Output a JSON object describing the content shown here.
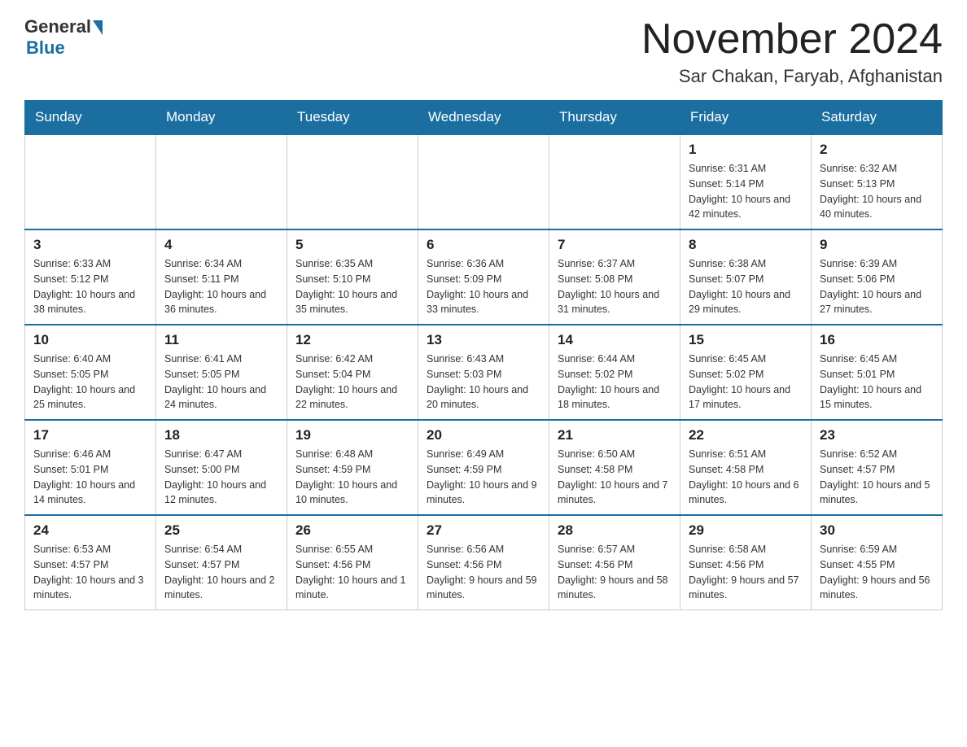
{
  "header": {
    "logo_general": "General",
    "logo_blue": "Blue",
    "month_title": "November 2024",
    "location": "Sar Chakan, Faryab, Afghanistan"
  },
  "days_of_week": [
    "Sunday",
    "Monday",
    "Tuesday",
    "Wednesday",
    "Thursday",
    "Friday",
    "Saturday"
  ],
  "weeks": [
    [
      {
        "day": "",
        "info": ""
      },
      {
        "day": "",
        "info": ""
      },
      {
        "day": "",
        "info": ""
      },
      {
        "day": "",
        "info": ""
      },
      {
        "day": "",
        "info": ""
      },
      {
        "day": "1",
        "info": "Sunrise: 6:31 AM\nSunset: 5:14 PM\nDaylight: 10 hours and 42 minutes."
      },
      {
        "day": "2",
        "info": "Sunrise: 6:32 AM\nSunset: 5:13 PM\nDaylight: 10 hours and 40 minutes."
      }
    ],
    [
      {
        "day": "3",
        "info": "Sunrise: 6:33 AM\nSunset: 5:12 PM\nDaylight: 10 hours and 38 minutes."
      },
      {
        "day": "4",
        "info": "Sunrise: 6:34 AM\nSunset: 5:11 PM\nDaylight: 10 hours and 36 minutes."
      },
      {
        "day": "5",
        "info": "Sunrise: 6:35 AM\nSunset: 5:10 PM\nDaylight: 10 hours and 35 minutes."
      },
      {
        "day": "6",
        "info": "Sunrise: 6:36 AM\nSunset: 5:09 PM\nDaylight: 10 hours and 33 minutes."
      },
      {
        "day": "7",
        "info": "Sunrise: 6:37 AM\nSunset: 5:08 PM\nDaylight: 10 hours and 31 minutes."
      },
      {
        "day": "8",
        "info": "Sunrise: 6:38 AM\nSunset: 5:07 PM\nDaylight: 10 hours and 29 minutes."
      },
      {
        "day": "9",
        "info": "Sunrise: 6:39 AM\nSunset: 5:06 PM\nDaylight: 10 hours and 27 minutes."
      }
    ],
    [
      {
        "day": "10",
        "info": "Sunrise: 6:40 AM\nSunset: 5:05 PM\nDaylight: 10 hours and 25 minutes."
      },
      {
        "day": "11",
        "info": "Sunrise: 6:41 AM\nSunset: 5:05 PM\nDaylight: 10 hours and 24 minutes."
      },
      {
        "day": "12",
        "info": "Sunrise: 6:42 AM\nSunset: 5:04 PM\nDaylight: 10 hours and 22 minutes."
      },
      {
        "day": "13",
        "info": "Sunrise: 6:43 AM\nSunset: 5:03 PM\nDaylight: 10 hours and 20 minutes."
      },
      {
        "day": "14",
        "info": "Sunrise: 6:44 AM\nSunset: 5:02 PM\nDaylight: 10 hours and 18 minutes."
      },
      {
        "day": "15",
        "info": "Sunrise: 6:45 AM\nSunset: 5:02 PM\nDaylight: 10 hours and 17 minutes."
      },
      {
        "day": "16",
        "info": "Sunrise: 6:45 AM\nSunset: 5:01 PM\nDaylight: 10 hours and 15 minutes."
      }
    ],
    [
      {
        "day": "17",
        "info": "Sunrise: 6:46 AM\nSunset: 5:01 PM\nDaylight: 10 hours and 14 minutes."
      },
      {
        "day": "18",
        "info": "Sunrise: 6:47 AM\nSunset: 5:00 PM\nDaylight: 10 hours and 12 minutes."
      },
      {
        "day": "19",
        "info": "Sunrise: 6:48 AM\nSunset: 4:59 PM\nDaylight: 10 hours and 10 minutes."
      },
      {
        "day": "20",
        "info": "Sunrise: 6:49 AM\nSunset: 4:59 PM\nDaylight: 10 hours and 9 minutes."
      },
      {
        "day": "21",
        "info": "Sunrise: 6:50 AM\nSunset: 4:58 PM\nDaylight: 10 hours and 7 minutes."
      },
      {
        "day": "22",
        "info": "Sunrise: 6:51 AM\nSunset: 4:58 PM\nDaylight: 10 hours and 6 minutes."
      },
      {
        "day": "23",
        "info": "Sunrise: 6:52 AM\nSunset: 4:57 PM\nDaylight: 10 hours and 5 minutes."
      }
    ],
    [
      {
        "day": "24",
        "info": "Sunrise: 6:53 AM\nSunset: 4:57 PM\nDaylight: 10 hours and 3 minutes."
      },
      {
        "day": "25",
        "info": "Sunrise: 6:54 AM\nSunset: 4:57 PM\nDaylight: 10 hours and 2 minutes."
      },
      {
        "day": "26",
        "info": "Sunrise: 6:55 AM\nSunset: 4:56 PM\nDaylight: 10 hours and 1 minute."
      },
      {
        "day": "27",
        "info": "Sunrise: 6:56 AM\nSunset: 4:56 PM\nDaylight: 9 hours and 59 minutes."
      },
      {
        "day": "28",
        "info": "Sunrise: 6:57 AM\nSunset: 4:56 PM\nDaylight: 9 hours and 58 minutes."
      },
      {
        "day": "29",
        "info": "Sunrise: 6:58 AM\nSunset: 4:56 PM\nDaylight: 9 hours and 57 minutes."
      },
      {
        "day": "30",
        "info": "Sunrise: 6:59 AM\nSunset: 4:55 PM\nDaylight: 9 hours and 56 minutes."
      }
    ]
  ]
}
